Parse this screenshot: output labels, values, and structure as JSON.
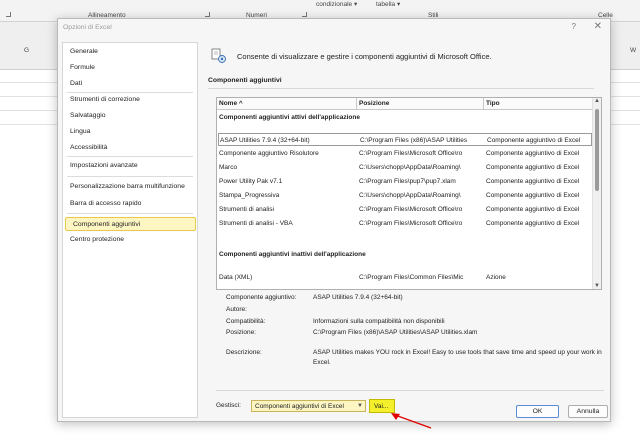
{
  "excel": {
    "ribbon": {
      "groups": [
        "Allineamento",
        "Numeri",
        "Stili",
        "Celle"
      ],
      "top_items": [
        "condizionale ▾",
        "tabella ▾"
      ]
    },
    "columns": [
      "G",
      "W"
    ]
  },
  "dialog": {
    "title": "Opzioni di Excel",
    "help": "?",
    "close": "✕",
    "nav": [
      "Generale",
      "Formule",
      "Dati",
      "Strumenti di correzione",
      "Salvataggio",
      "Lingua",
      "Accessibilità",
      "Impostazioni avanzate",
      "Personalizzazione barra multifunzione",
      "Barra di accesso rapido",
      "Componenti aggiuntivi",
      "Centro protezione"
    ],
    "selected_nav": "Componenti aggiuntivi",
    "header_text": "Consente di visualizzare e gestire i componenti aggiuntivi di Microsoft Office.",
    "section_title": "Componenti aggiuntivi",
    "table": {
      "headers": [
        "Nome ^",
        "Posizione",
        "Tipo"
      ],
      "group_active": "Componenti aggiuntivi attivi dell'applicazione",
      "active_rows": [
        [
          "ASAP Utilities 7.9.4 (32+64-bit)",
          "C:\\Program Files (x86)\\ASAP Utilities",
          "Componente aggiuntivo di Excel"
        ],
        [
          "Componente aggiuntivo Risolutore",
          "C:\\Program Files\\Microsoft Office\\ro",
          "Componente aggiuntivo di Excel"
        ],
        [
          "Marco",
          "C:\\Users\\chopp\\AppData\\Roaming\\",
          "Componente aggiuntivo di Excel"
        ],
        [
          "Power Utility Pak v7.1",
          "C:\\Program Files\\pup7\\pup7.xlam",
          "Componente aggiuntivo di Excel"
        ],
        [
          "Stampa_Progressiva",
          "C:\\Users\\chopp\\AppData\\Roaming\\",
          "Componente aggiuntivo di Excel"
        ],
        [
          "Strumenti di analisi",
          "C:\\Program Files\\Microsoft Office\\ro",
          "Componente aggiuntivo di Excel"
        ],
        [
          "Strumenti di analisi - VBA",
          "C:\\Program Files\\Microsoft Office\\ro",
          "Componente aggiuntivo di Excel"
        ]
      ],
      "group_inactive": "Componenti aggiuntivi inattivi dell'applicazione",
      "inactive_rows": [
        [
          "Data (XML)",
          "C:\\Program Files\\Common Files\\Mic",
          "Azione"
        ]
      ]
    },
    "details": {
      "addin_label": "Componente aggiuntivo:",
      "addin_value": "ASAP Utilities 7.9.4 (32+64-bit)",
      "author_label": "Autore:",
      "compat_label": "Compatibilità:",
      "compat_value": "Informazioni sulla compatibilità non disponibili",
      "position_label": "Posizione:",
      "position_value": "C:\\Program Files (x86)\\ASAP Utilities\\ASAP Utilities.xlam",
      "desc_label": "Descrizione:",
      "desc_value": "ASAP Utilities makes YOU rock in Excel! Easy to use tools that save time and speed up your work in Excel."
    },
    "manage_label": "Gestisci:",
    "manage_value": "Componenti aggiuntivi di Excel",
    "go_button": "Vai...",
    "ok_button": "OK",
    "cancel_button": "Annulla",
    "colors": {
      "highlight": "#fdf6c3",
      "go_highlight": "#f3ef2a",
      "arrow": "#e00000"
    }
  }
}
